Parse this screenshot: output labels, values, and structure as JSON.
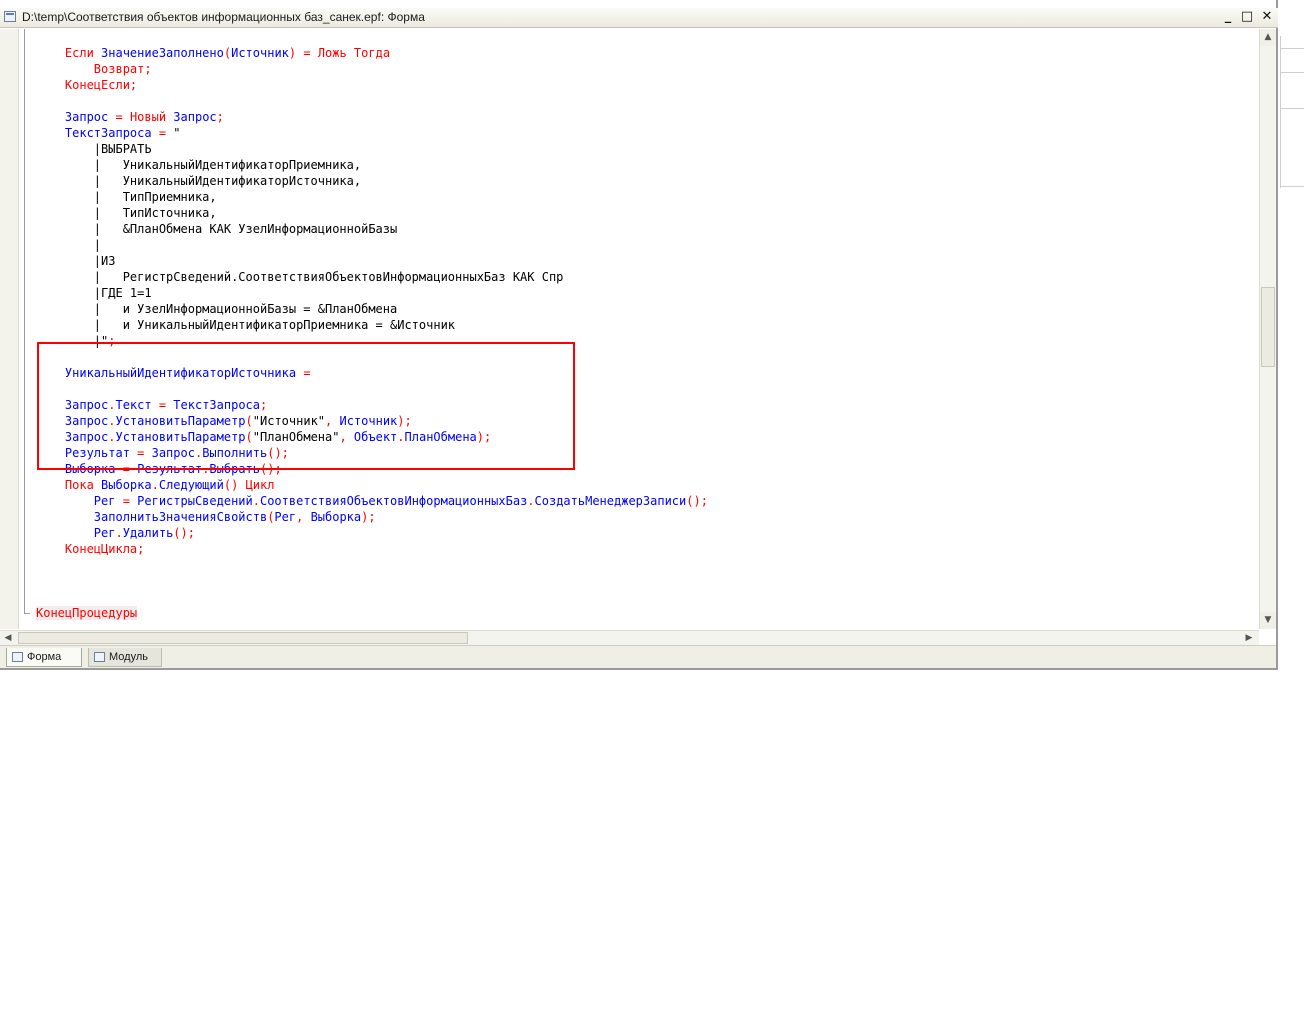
{
  "window": {
    "title": "D:\\temp\\Соответствия объектов информационных баз_санек.epf: Форма",
    "minimize": "_",
    "maximize": "□",
    "close": "✕"
  },
  "tabs": [
    {
      "label": "Форма",
      "icon": "form-icon",
      "active": true
    },
    {
      "label": "Модуль",
      "icon": "module-icon",
      "active": false
    }
  ],
  "scroll": {
    "up": "▲",
    "down": "▼",
    "left": "◀",
    "right": "▶"
  },
  "code_lines": [
    [
      [
        "kw",
        "    Если "
      ],
      [
        "id",
        "ЗначениеЗаполнено"
      ],
      [
        "op",
        "("
      ],
      [
        "id",
        "Источник"
      ],
      [
        "op",
        ") = "
      ],
      [
        "kw",
        "Ложь Тогда"
      ]
    ],
    [
      [
        "kw",
        "        Возврат"
      ],
      [
        "op",
        ";"
      ]
    ],
    [
      [
        "kw",
        "    КонецЕсли"
      ],
      [
        "op",
        ";"
      ]
    ],
    [
      [
        "str",
        ""
      ]
    ],
    [
      [
        "id",
        "    Запрос "
      ],
      [
        "op",
        "= "
      ],
      [
        "kw",
        "Новый "
      ],
      [
        "id",
        "Запрос"
      ],
      [
        "op",
        ";"
      ]
    ],
    [
      [
        "id",
        "    ТекстЗапроса "
      ],
      [
        "op",
        "= "
      ],
      [
        "str",
        "\""
      ]
    ],
    [
      [
        "str",
        "        |ВЫБРАТЬ"
      ]
    ],
    [
      [
        "str",
        "        |   УникальныйИдентификаторПриемника,"
      ]
    ],
    [
      [
        "str",
        "        |   УникальныйИдентификаторИсточника,"
      ]
    ],
    [
      [
        "str",
        "        |   ТипПриемника,"
      ]
    ],
    [
      [
        "str",
        "        |   ТипИсточника,"
      ]
    ],
    [
      [
        "str",
        "        |   &ПланОбмена КАК УзелИнформационнойБазы"
      ]
    ],
    [
      [
        "str",
        "        |"
      ]
    ],
    [
      [
        "str",
        "        |ИЗ"
      ]
    ],
    [
      [
        "str",
        "        |   РегистрСведений.СоответствияОбъектовИнформационныхБаз КАК Спр"
      ]
    ],
    [
      [
        "str",
        "        |ГДЕ 1=1"
      ]
    ],
    [
      [
        "str",
        "        |   и УзелИнформационнойБазы = &ПланОбмена"
      ]
    ],
    [
      [
        "str",
        "        |   и УникальныйИдентификаторПриемника = &Источник"
      ]
    ],
    [
      [
        "str",
        "        |\""
      ],
      [
        "op",
        ";"
      ]
    ],
    [
      [
        "str",
        ""
      ]
    ],
    [
      [
        "id",
        "    УникальныйИдентификаторИсточника "
      ],
      [
        "op",
        "="
      ]
    ],
    [
      [
        "str",
        ""
      ]
    ],
    [
      [
        "id",
        "    Запрос"
      ],
      [
        "op",
        "."
      ],
      [
        "id",
        "Текст "
      ],
      [
        "op",
        "= "
      ],
      [
        "id",
        "ТекстЗапроса"
      ],
      [
        "op",
        ";"
      ]
    ],
    [
      [
        "id",
        "    Запрос"
      ],
      [
        "op",
        "."
      ],
      [
        "id",
        "УстановитьПараметр"
      ],
      [
        "op",
        "("
      ],
      [
        "str",
        "\"Источник\""
      ],
      [
        "op",
        ", "
      ],
      [
        "id",
        "Источник"
      ],
      [
        "op",
        ");"
      ]
    ],
    [
      [
        "id",
        "    Запрос"
      ],
      [
        "op",
        "."
      ],
      [
        "id",
        "УстановитьПараметр"
      ],
      [
        "op",
        "("
      ],
      [
        "str",
        "\"ПланОбмена\""
      ],
      [
        "op",
        ", "
      ],
      [
        "id",
        "Объект"
      ],
      [
        "op",
        "."
      ],
      [
        "id",
        "ПланОбмена"
      ],
      [
        "op",
        ");"
      ]
    ],
    [
      [
        "id",
        "    Результат "
      ],
      [
        "op",
        "= "
      ],
      [
        "id",
        "Запрос"
      ],
      [
        "op",
        "."
      ],
      [
        "id",
        "Выполнить"
      ],
      [
        "op",
        "();"
      ]
    ],
    [
      [
        "id",
        "    Выборка "
      ],
      [
        "op",
        "= "
      ],
      [
        "id",
        "Результат"
      ],
      [
        "op",
        "."
      ],
      [
        "id",
        "Выбрать"
      ],
      [
        "op",
        "();"
      ]
    ],
    [
      [
        "kw",
        "    Пока "
      ],
      [
        "id",
        "Выборка"
      ],
      [
        "op",
        "."
      ],
      [
        "id",
        "Следующий"
      ],
      [
        "op",
        "() "
      ],
      [
        "kw",
        "Цикл"
      ]
    ],
    [
      [
        "id",
        "        Рег "
      ],
      [
        "op",
        "= "
      ],
      [
        "id",
        "РегистрыСведений"
      ],
      [
        "op",
        "."
      ],
      [
        "id",
        "СоответствияОбъектовИнформационныхБаз"
      ],
      [
        "op",
        "."
      ],
      [
        "id",
        "СоздатьМенеджерЗаписи"
      ],
      [
        "op",
        "();"
      ]
    ],
    [
      [
        "id",
        "        ЗаполнитьЗначенияСвойств"
      ],
      [
        "op",
        "("
      ],
      [
        "id",
        "Рег"
      ],
      [
        "op",
        ", "
      ],
      [
        "id",
        "Выборка"
      ],
      [
        "op",
        ");"
      ]
    ],
    [
      [
        "id",
        "        Рег"
      ],
      [
        "op",
        "."
      ],
      [
        "id",
        "Удалить"
      ],
      [
        "op",
        "();"
      ]
    ],
    [
      [
        "kw",
        "    КонецЦикла"
      ],
      [
        "op",
        ";"
      ]
    ],
    [
      [
        "str",
        ""
      ]
    ],
    [
      [
        "str",
        ""
      ]
    ],
    [
      [
        "str",
        ""
      ]
    ],
    [
      [
        "proc",
        "КонецПроцедуры"
      ]
    ]
  ]
}
